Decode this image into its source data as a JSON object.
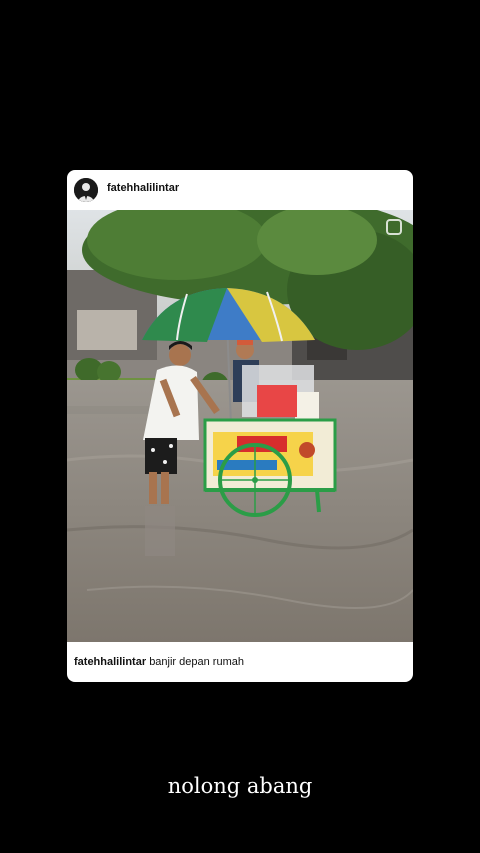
{
  "post": {
    "username": "fatehhalilintar",
    "caption_user": "fatehhalilintar",
    "caption_text": "banjir depan rumah",
    "avatar_icon": "profile-avatar-icon",
    "photo_icon": "flood-street-photo"
  },
  "story": {
    "text": "nolong abang"
  },
  "colors": {
    "background": "#000000",
    "card": "#ffffff"
  }
}
